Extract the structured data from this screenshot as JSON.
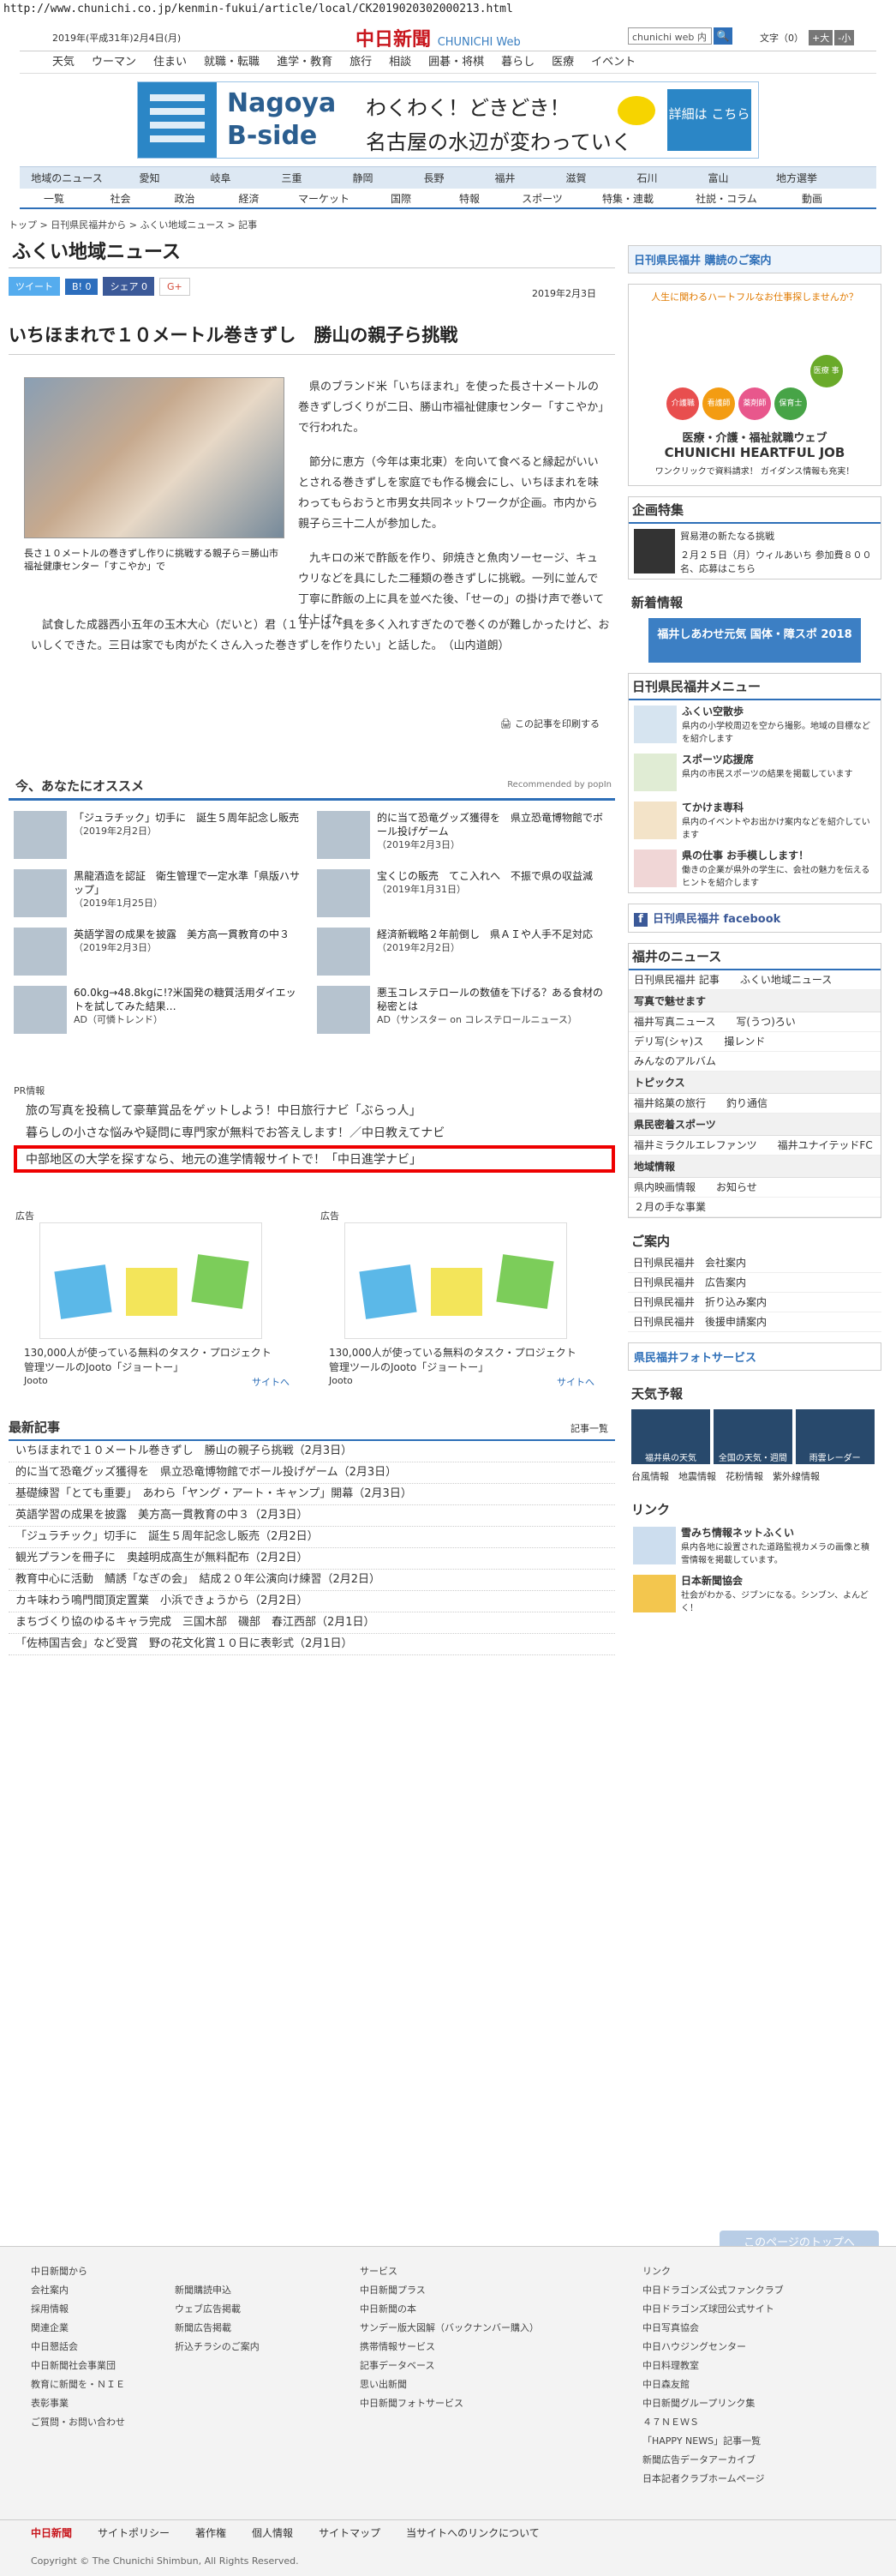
{
  "browser": {
    "url": "http://www.chunichi.co.jp/kenmin-fukui/article/local/CK2019020302000213.html"
  },
  "header": {
    "date": "2019年(平成31年)2月4日(月)",
    "logo": "中日新聞",
    "logo_sub": "CHUNICHI Web",
    "search_placeholder": "chunichi web 内",
    "search_btn": "🔍",
    "font_label": "文字（0）",
    "font_plus": "+大",
    "font_minus": "-小"
  },
  "gnav": [
    "天気",
    "ウーマン",
    "住まい",
    "就職・転職",
    "進学・教育",
    "旅行",
    "相談",
    "囲碁・将棋",
    "暮らし",
    "医療",
    "イベント"
  ],
  "banner": {
    "title1": "Nagoya",
    "title2": "B-side",
    "copy1": "わくわく！どきどき！",
    "copy2": "名古屋の水辺が変わっていく",
    "button": "詳細は こちら"
  },
  "local_nav": [
    "地域のニュース",
    "愛知",
    "岐阜",
    "三重",
    "静岡",
    "長野",
    "福井",
    "滋賀",
    "石川",
    "富山",
    "地方選挙"
  ],
  "cat_nav": [
    "一覧",
    "社会",
    "政治",
    "経済",
    "マーケット",
    "国際",
    "特報",
    "スポーツ",
    "特集・連載",
    "社説・コラム",
    "動画"
  ],
  "breadcrumb": "トップ > 日刊県民福井から > ふくい地域ニュース > 記事",
  "section": "ふくい地域ニュース",
  "share": {
    "tweet": "ツイート",
    "hatena": "B! 0",
    "fb": "シェア 0",
    "gplus": "G+",
    "pubdate": "2019年2月3日"
  },
  "article": {
    "title": "いちほまれで１０メートル巻きずし　勝山の親子ら挑戦",
    "caption": "長さ１０メートルの巻きずし作りに挑戦する親子ら＝勝山市福祉健康センター「すこやか」で",
    "p1": "県のブランド米「いちほまれ」を使った長さ十メートルの巻きずしづくりが二日、勝山市福祉健康センター「すこやか」で行われた。",
    "p2": "節分に恵方（今年は東北東）を向いて食べると縁起がいいとされる巻きずしを家庭でも作る機会にし、いちほまれを味わってもらおうと市男女共同ネットワークが企画。市内から親子ら三十二人が参加した。",
    "p3": "九キロの米で酢飯を作り、卵焼きと魚肉ソーセージ、キュウリなどを具にした二種類の巻きずしに挑戦。一列に並んで丁寧に酢飯の上に具を並べた後、「せーの」の掛け声で巻いて仕上げた。",
    "p4": "試食した成器西小五年の玉木大心（だいと）君（１１）は「具を多く入れすぎたので巻くのが難しかったけど、おいしくできた。三日は家でも肉がたくさん入った巻きずしを作りたい」と話した。　（山内道朗）",
    "print": "この記事を印刷する"
  },
  "recommend": {
    "title": "今、あなたにオススメ",
    "by": "Recommended by popIn",
    "items": [
      {
        "t": "「ジュラチック」切手に　誕生５周年記念し販売",
        "d": "（2019年2月2日）"
      },
      {
        "t": "的に当て恐竜グッズ獲得を　県立恐竜博物館でボール投げゲーム",
        "d": "（2019年2月3日）"
      },
      {
        "t": "黒龍酒造を認証　衛生管理で一定水準「県版ハサップ」",
        "d": "（2019年1月25日）"
      },
      {
        "t": "宝くじの販売　てこ入れへ　不振で県の収益減",
        "d": "（2019年1月31日）"
      },
      {
        "t": "英語学習の成果を披露　美方高一貫教育の中３",
        "d": "（2019年2月3日）"
      },
      {
        "t": "経済新戦略２年前倒し　県ＡＩや人手不足対応",
        "d": "（2019年2月2日）"
      },
      {
        "t": "60.0kg→48.8kgに!?米国発の糖質活用ダイエットを試してみた結果…",
        "d": "AD（可憐トレンド）"
      },
      {
        "t": "悪玉コレステロールの数値を下げる？ある食材の秘密とは",
        "d": "AD（サンスター on コレステロールニュース）"
      }
    ]
  },
  "pr": {
    "label": "PR情報",
    "items": [
      "旅の写真を投稿して豪華賞品をゲットしよう！中日旅行ナビ「ぶらっ人」",
      "暮らしの小さな悩みや疑問に専門家が無料でお答えします！／中日教えてナビ"
    ],
    "highlight": "中部地区の大学を探すなら、地元の進学情報サイトで！「中日進学ナビ」"
  },
  "ads": [
    {
      "label": "広告",
      "text": "130,000人が使っている無料のタスク・プロジェクト管理ツールのJooto「ジョートー」",
      "brand": "Jooto",
      "site": "サイトへ"
    },
    {
      "label": "広告",
      "text": "130,000人が使っている無料のタスク・プロジェクト管理ツールのJooto「ジョートー」",
      "brand": "Jooto",
      "site": "サイトへ"
    }
  ],
  "latest": {
    "title": "最新記事",
    "more": "記事一覧",
    "items": [
      "いちほまれで１０メートル巻きずし　勝山の親子ら挑戦（2月3日）",
      "的に当て恐竜グッズ獲得を　県立恐竜博物館でボール投げゲーム（2月3日）",
      "基礎練習「とても重要」　あわら「ヤング・アート・キャンプ」開幕（2月3日）",
      "英語学習の成果を披露　美方高一貫教育の中３（2月3日）",
      "「ジュラチック」切手に　誕生５周年記念し販売（2月2日）",
      "観光プランを冊子に　奥越明成高生が無料配布（2月2日）",
      "教育中心に活動　鯖誘「なぎの会」　結成２０年公演向け練習（2月2日）",
      "カキ味わう鳴門間頂定置業　小浜できょうから（2月2日）",
      "まちづくり協のゆるキャラ完成　三国木部　磯部　春江西部（2月1日）",
      "「佐柿国吉会」など受賞　野の花文化賞１０日に表彰式（2月1日）"
    ]
  },
  "side": {
    "subscribe": "日刊県民福井 購読のご案内",
    "job_head": "人生に関わるハートフルなお仕事探しませんか？",
    "job_cats": [
      "介護職",
      "看護師",
      "薬剤師",
      "保育士",
      "医療 事務"
    ],
    "job_title": "医療・介護・福祉就職ウェブ",
    "job_brand": "CHUNICHI HEARTFUL JOB",
    "job_foot": "ワンクリックで資料請求！ ガイダンス情報も充実！",
    "feature_title": "企画特集",
    "feature_text": "貿易港の新たなる挑戦",
    "feature_date": "２月２５日（月）ウィルあいち 参加費８００名、応募はこちら",
    "new_title": "新着情報",
    "new_banner": "福井しあわせ元気 国体・障スポ 2018",
    "menu_title": "日刊県民福井メニュー",
    "menu": [
      {
        "n": "ふくい空散歩",
        "d": "県内の小学校周辺を空から撮影。地域の目標などを紹介します"
      },
      {
        "n": "スポーツ応援席",
        "d": "県内の市民スポーツの結果を掲載しています"
      },
      {
        "n": "てかけま専科",
        "d": "県内のイベントやお出かけ案内などを紹介しています"
      },
      {
        "n": "県の仕事 お手模しします！",
        "d": "働きの企業が県外の学生に、会社の魅力を伝えるヒントを紹介します"
      }
    ],
    "facebook": "日刊県民福井 facebook",
    "fnews_title": "福井のニュース",
    "fnews": [
      "日刊県民福井 記事",
      "ふくい地域ニュース"
    ],
    "photo_title": "写真で魅せます",
    "photo": [
      "福井写真ニュース",
      "写(うつ)ろい",
      "デリ写(シャ)ス",
      "撮レンド",
      "みんなのアルバム"
    ],
    "topics_title": "トピックス",
    "topics": [
      "福井銘菓の旅行",
      "釣り通信"
    ],
    "sports_title": "県民密着スポーツ",
    "sports": [
      "福井ミラクルエレファンツ",
      "福井ユナイテッドFC"
    ],
    "region_title": "地域情報",
    "region": [
      "県内映画情報",
      "お知らせ",
      "２月の手な事業"
    ],
    "guide_title": "ご案内",
    "guide": [
      "日刊県民福井　会社案内",
      "日刊県民福井　広告案内",
      "日刊県民福井　折り込み案内",
      "日刊県民福井　後援申請案内"
    ],
    "photo_service": "県民福井フォトサービス",
    "weather_title": "天気予報",
    "weather_imgs": [
      "福井県の天気",
      "全国の天気・週間",
      "雨雲レーダー"
    ],
    "weather_links": [
      "台風情報",
      "地震情報",
      "花粉情報",
      "紫外線情報"
    ],
    "link_title": "リンク",
    "links": [
      {
        "n": "雪みち情報ネットふくい",
        "d": "県内各地に設置された道路監視カメラの画像と積雪情報を掲載しています。"
      },
      {
        "n": "日本新聞協会",
        "d": "社会がわかる、ジブンになる。シンブン、よんどく！"
      }
    ]
  },
  "totop": "このページのトップへ",
  "footer": {
    "col1_title": "中日新聞から",
    "col1": [
      "会社案内",
      "採用情報",
      "関連企業",
      "中日懇話会",
      "中日新聞社会事業団",
      "教育に新聞を・ＮＩＥ",
      "表彰事業",
      "ご質問・お問い合わせ"
    ],
    "col1b": [
      "新聞購読申込",
      "ウェブ広告掲載",
      "新聞広告掲載",
      "折込チラシのご案内"
    ],
    "col2_title": "サービス",
    "col2": [
      "中日新聞プラス",
      "中日新聞の本",
      "サンデー版大図解（バックナンバー購入）",
      "携帯情報サービス",
      "記事データベース",
      "思い出新聞",
      "中日新聞フォトサービス"
    ],
    "col3_title": "リンク",
    "col3": [
      "中日ドラゴンズ公式ファンクラブ",
      "中日ドラゴンズ球団公式サイト",
      "中日写真協会",
      "中日ハウジングセンター",
      "中日料理教室",
      "中日森友館",
      "中日新聞グループリンク集",
      "４７ＮＥＷＳ",
      "「HAPPY NEWS」記事一覧",
      "新聞広告データアーカイブ",
      "日本記者クラブホームページ"
    ],
    "bar": [
      "中日新聞",
      "サイトポリシー",
      "著作権",
      "個人情報",
      "サイトマップ",
      "当サイトへのリンクについて"
    ],
    "copyright": "Copyright © The Chunichi Shimbun, All Rights Reserved."
  },
  "colors": {
    "accent": "#2e6fb8",
    "logo": "#c8161d",
    "highlight_border": "#e00"
  }
}
